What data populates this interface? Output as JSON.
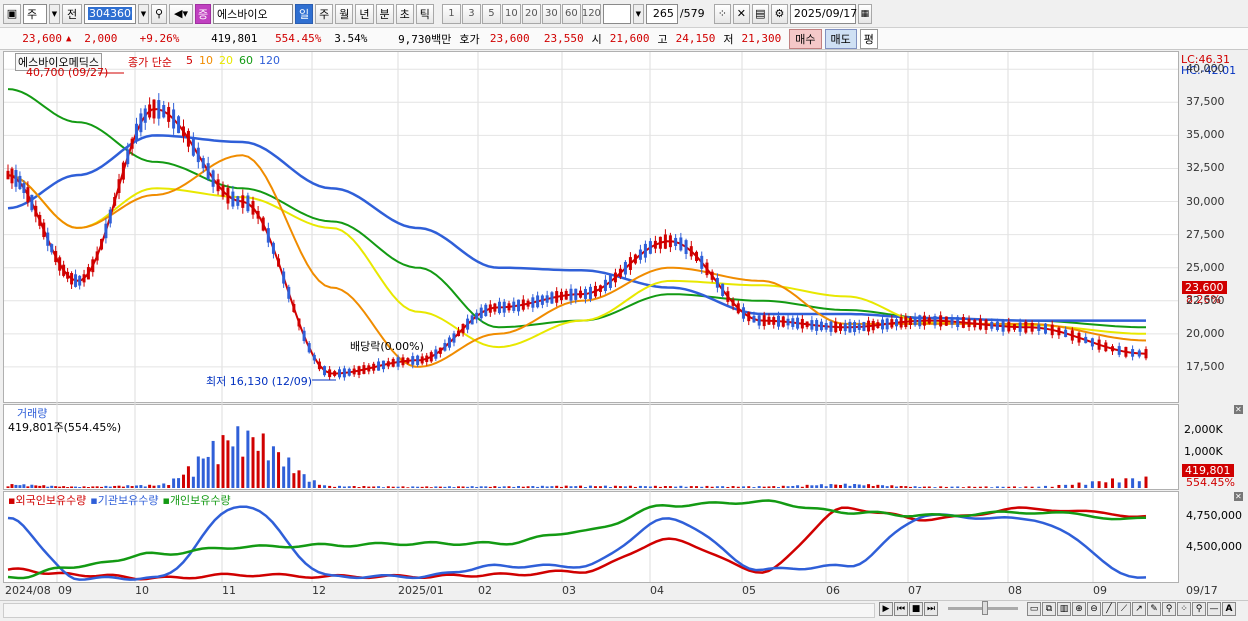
{
  "toolbar": {
    "period_type": "주",
    "period_prev": "전",
    "code": "304360",
    "stock_name": "에스바이오",
    "period_day": "일",
    "period_week": "주",
    "period_month": "월",
    "period_year": "년",
    "period_min": "분",
    "period_sec": "초",
    "period_tick": "틱",
    "intervals": [
      "1",
      "3",
      "5",
      "10",
      "20",
      "30",
      "60",
      "120"
    ],
    "count": "265",
    "total": "/579",
    "date": "2025/09/17"
  },
  "quote": {
    "price": "23,600",
    "change": "2,000",
    "change_pct": "+9.26%",
    "volume": "419,801",
    "volume_pct": "554.45%",
    "turnover": "3.54%",
    "amount": "9,730백만",
    "ask_label": "호가",
    "ask": "23,600",
    "bid": "23,550",
    "open_label": "시",
    "open": "21,600",
    "high_label": "고",
    "high": "24,150",
    "low_label": "저",
    "low": "21,300",
    "buy": "매수",
    "sell": "매도",
    "eval": "평"
  },
  "main_chart": {
    "name_tag": "에스바이오메딕스",
    "ma_title": "종가 단순",
    "ma_periods": [
      {
        "label": "5",
        "color": "#d00000"
      },
      {
        "label": "10",
        "color": "#f08c00"
      },
      {
        "label": "20",
        "color": "#e8e800"
      },
      {
        "label": "60",
        "color": "#139a13"
      },
      {
        "label": "120",
        "color": "#2f5fd8"
      }
    ],
    "high_annotation": "40,700 (09/27)",
    "low_annotation": "최저 16,130 (12/09)",
    "dividend_annotation": "배당락(0.00%)",
    "lc_label": "LC:46.31",
    "hc_label": "HC:-42.01",
    "price_tag": "23,600",
    "pct_tag": "8.26%",
    "y_ticks": [
      "40,000",
      "37,500",
      "35,000",
      "32,500",
      "30,000",
      "27,500",
      "25,000",
      "22,500",
      "20,000",
      "17,500"
    ]
  },
  "volume_chart": {
    "title": "거래량",
    "info": "419,801주(554.45%)",
    "y_ticks": [
      "2,000K",
      "1,000K"
    ],
    "vol_tag": "419,801",
    "pct_tag": "554.45%"
  },
  "holding_chart": {
    "legend": [
      {
        "label": "외국인보유수량",
        "color": "#d00000"
      },
      {
        "label": "기관보유수량",
        "color": "#2f5fd8"
      },
      {
        "label": "개인보유수량",
        "color": "#139a13"
      }
    ],
    "y_ticks": [
      "4,750,000",
      "4,500,000"
    ]
  },
  "x_axis": [
    "2024/08",
    "09",
    "10",
    "11",
    "12",
    "2025/01",
    "02",
    "03",
    "04",
    "05",
    "06",
    "07",
    "08",
    "09"
  ],
  "x_axis_end": "09/17",
  "chart_data": [
    {
      "type": "line",
      "title": "",
      "x": [
        "2024/08",
        "09",
        "10",
        "11",
        "12",
        "2025/01",
        "02",
        "03",
        "04",
        "05",
        "06",
        "07",
        "08",
        "09"
      ],
      "series": [
        {
          "name": "5",
          "values": [
            32000,
            24000,
            37000,
            30000,
            17000,
            18000,
            22000,
            23000,
            27000,
            21000,
            20500,
            21000,
            20500,
            18500
          ]
        },
        {
          "name": "120",
          "values": [
            29500,
            32000,
            35000,
            34500,
            31000,
            28000,
            25000,
            24800,
            23500,
            21500,
            21500,
            21200,
            21000,
            21000
          ]
        },
        {
          "name": "60",
          "values": [
            38500,
            36000,
            33000,
            31000,
            28500,
            25000,
            20500,
            21000,
            23000,
            22500,
            21800,
            21200,
            21000,
            20500
          ]
        }
      ],
      "ylim": [
        15000,
        41000
      ]
    },
    {
      "type": "bar",
      "title": "거래량",
      "categories": [
        "2024/08",
        "09",
        "10",
        "11",
        "12",
        "2025/01",
        "02",
        "03",
        "04",
        "05",
        "06",
        "07",
        "08",
        "09"
      ],
      "values": [
        150,
        60,
        120,
        2300,
        80,
        60,
        70,
        90,
        80,
        70,
        160,
        60,
        60,
        420
      ]
    },
    {
      "type": "line",
      "title": "",
      "x": [
        "2024/08",
        "09",
        "10",
        "11",
        "12",
        "2025/01",
        "02",
        "03",
        "04",
        "05",
        "06",
        "07",
        "08",
        "09"
      ],
      "series": [
        {
          "name": "외국인보유수량",
          "values": [
            4430000,
            4400000,
            4380000,
            4400000,
            4390000,
            4390000,
            4400000,
            4420000,
            4600000,
            4420000,
            4780000,
            4720000,
            4780000,
            4740000
          ]
        },
        {
          "name": "기관보유수량",
          "values": [
            4720000,
            4380000,
            4380000,
            4800000,
            4390000,
            4390000,
            4450000,
            4450000,
            4720000,
            4430000,
            4450000,
            4740000,
            4720000,
            4380000
          ]
        },
        {
          "name": "개인보유수량",
          "values": [
            4380000,
            4450000,
            4520000,
            4560000,
            4570000,
            4580000,
            4580000,
            4650000,
            4800000,
            4820000,
            4760000,
            4740000,
            4760000,
            4720000
          ]
        }
      ]
    }
  ]
}
